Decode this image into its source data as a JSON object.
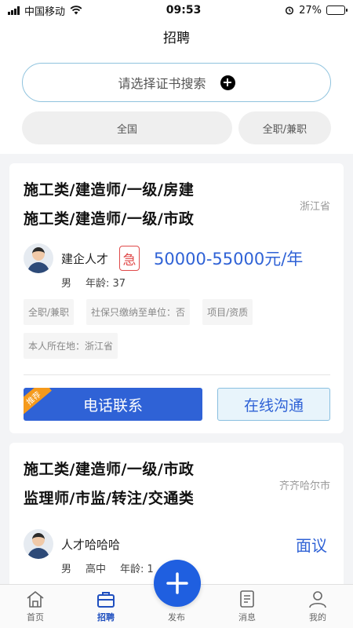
{
  "status_bar": {
    "carrier": "中国移动",
    "time": "09:53",
    "battery_percent": "27%",
    "battery_level": 0.27
  },
  "header": {
    "title": "招聘"
  },
  "search": {
    "placeholder": "请选择证书搜索"
  },
  "filters": {
    "region": "全国",
    "job_type": "全职/兼职"
  },
  "cards": [
    {
      "titles": [
        "施工类/建造师/一级/房建",
        "施工类/建造师/一级/市政"
      ],
      "region": "浙江省",
      "poster_name": "建企人才",
      "urgent_label": "急",
      "salary": "50000-55000元/年",
      "meta": [
        "男",
        "年龄: 37"
      ],
      "tags": [
        "全职/兼职",
        "社保只缴纳至单位：否",
        "项目/资质",
        "本人所在地：浙江省"
      ],
      "recommend_label": "推荐",
      "call_label": "电话联系",
      "chat_label": "在线沟通"
    },
    {
      "titles": [
        "施工类/建造师/一级/市政",
        "监理师/市监/转注/交通类"
      ],
      "region": "齐齐哈尔市",
      "poster_name": "人才哈哈哈",
      "salary": "面议",
      "meta": [
        "男",
        "高中",
        "年龄: 1"
      ]
    }
  ],
  "tabbar": {
    "items": [
      {
        "label": "首页",
        "icon": "home-icon"
      },
      {
        "label": "招聘",
        "icon": "briefcase-icon",
        "active": true
      },
      {
        "label": "发布",
        "icon": "plus-icon"
      },
      {
        "label": "消息",
        "icon": "message-icon"
      },
      {
        "label": "我的",
        "icon": "user-icon"
      }
    ]
  },
  "colors": {
    "accent": "#2f62d6",
    "fab": "#1f5fe0",
    "urgent": "#e04a4a",
    "recommend": "#f59a1b"
  }
}
